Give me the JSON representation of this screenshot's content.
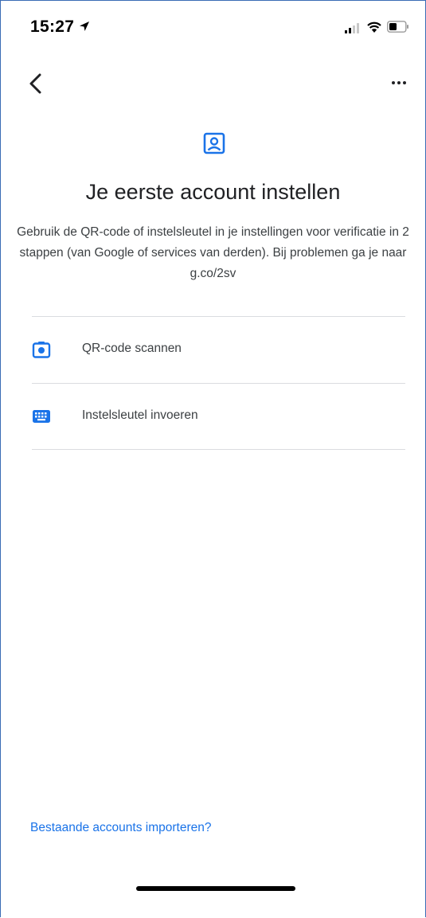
{
  "status_bar": {
    "time": "15:27",
    "icons": [
      "location-arrow-icon",
      "cellular-signal-icon",
      "wifi-icon",
      "battery-icon"
    ]
  },
  "app_bar": {
    "back_icon": "chevron-left-icon",
    "more_icon": "more-horizontal-icon"
  },
  "header": {
    "icon": "account-badge-icon",
    "title": "Je eerste account instellen",
    "description": "Gebruik de QR-code of instelsleutel in je instellingen voor verificatie in 2 stappen (van Google of services van derden). Bij problemen ga je naar g.co/2sv"
  },
  "options": [
    {
      "icon": "camera-icon",
      "label": "QR-code scannen"
    },
    {
      "icon": "keyboard-icon",
      "label": "Instelsleutel invoeren"
    }
  ],
  "footer": {
    "import_link": "Bestaande accounts importeren?"
  },
  "colors": {
    "accent": "#1a73e8",
    "text_primary": "#202124",
    "text_secondary": "#3c4043",
    "divider": "#dadce0"
  }
}
